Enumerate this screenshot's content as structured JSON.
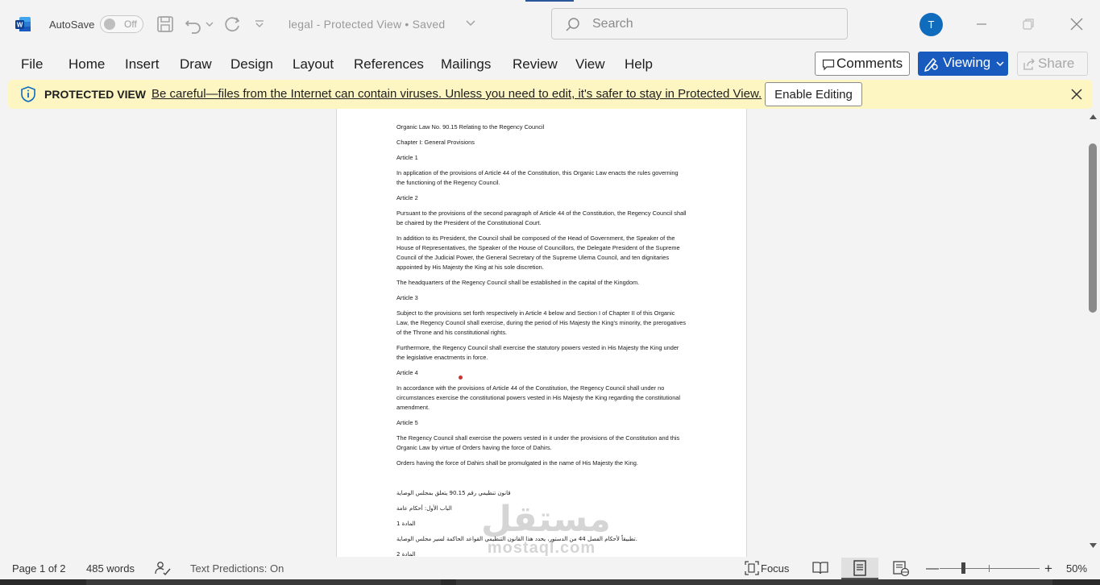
{
  "titlebar": {
    "autosave_label": "AutoSave",
    "autosave_state": "Off",
    "doc_title": "legal  -  Protected View • Saved",
    "search_placeholder": "Search",
    "avatar_initial": "T"
  },
  "menu": {
    "items": [
      "File",
      "Home",
      "Insert",
      "Draw",
      "Design",
      "Layout",
      "References",
      "Mailings",
      "Review",
      "View",
      "Help"
    ],
    "comments_label": "Comments",
    "viewing_label": "Viewing",
    "share_label": "Share"
  },
  "protected_view": {
    "title": "PROTECTED VIEW",
    "message": "Be careful—files from the Internet can contain viruses. Unless you need to edit, it's safer to stay in Protected View.",
    "enable_label": "Enable Editing"
  },
  "document": {
    "paragraphs": [
      "Organic Law No. 90.15 Relating to the Regency Council",
      "Chapter I: General Provisions",
      "Article 1",
      "In application of the provisions of Article 44 of the Constitution, this Organic Law enacts the rules governing the functioning of the Regency Council.",
      "Article 2",
      "Pursuant to the provisions of the second paragraph of Article 44 of the Constitution, the Regency Council shall be chaired by the President of the Constitutional Court.",
      "In addition to its President, the Council shall be composed of the Head of Government, the Speaker of the House of Representatives, the Speaker of the House of Councillors, the Delegate President of the Supreme Council of the Judicial Power, the General Secretary of the Supreme Ulema Council, and ten dignitaries appointed by His Majesty the King at his sole discretion.",
      "The headquarters of the Regency Council shall be established in the capital of the Kingdom.",
      "Article 3",
      "Subject to the provisions set forth respectively in Article 4 below and Section I of Chapter II of this Organic Law, the Regency Council shall exercise, during the period of His Majesty the King's minority, the prerogatives of the Throne and his constitutional rights.",
      "Furthermore, the Regency Council shall exercise the statutory powers vested in His Majesty the King under the legislative enactments in force.",
      "Article 4",
      "In accordance with the provisions of Article 44 of the Constitution, the Regency Council shall under no circumstances exercise the constitutional powers vested in His Majesty the King regarding the constitutional amendment.",
      "Article 5",
      "The Regency Council shall exercise the powers vested in it under the provisions of the Constitution and this Organic Law by virtue of Orders having the force of Dahirs.",
      "Orders having the force of Dahirs shall be promulgated in the name of His Majesty the King."
    ],
    "arabic_paragraphs": [
      "قانون تنظيمي رقم 90.15 يتعلق بمجلس الوصاية",
      "الباب الأول: أحكام عامة",
      "المادة 1",
      "تطبيقاً لأحكام الفصل 44 من الدستور، يحدد هذا القانون التنظيمي القواعد الحاكمة لسير مجلس الوصاية.",
      "المادة 2"
    ]
  },
  "watermark": {
    "arabic": "مستقل",
    "latin": "mostaql.com"
  },
  "status": {
    "page": "Page 1 of 2",
    "words": "485 words",
    "predictions": "Text Predictions: On",
    "focus": "Focus",
    "zoom": "50%",
    "zoom_level_percent": 50
  },
  "colors": {
    "accent": "#185abd",
    "protected_bg": "#fdf6c3",
    "avatar": "#0f6cbd"
  }
}
